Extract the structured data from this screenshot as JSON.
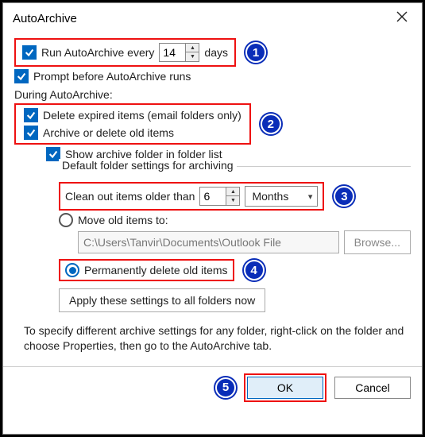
{
  "title": "AutoArchive",
  "run_every": {
    "label_prefix": "Run AutoArchive every",
    "value": "14",
    "label_suffix": "days"
  },
  "prompt_label": "Prompt before AutoArchive runs",
  "during_label": "During AutoArchive:",
  "delete_expired_label": "Delete expired items (email folders only)",
  "archive_delete_label": "Archive or delete old items",
  "show_folder_label": "Show archive folder in folder list",
  "group_legend": "Default folder settings for archiving",
  "clean_out": {
    "label": "Clean out items older than",
    "value": "6",
    "unit": "Months"
  },
  "move_label": "Move old items to:",
  "path_value": "C:\\Users\\Tanvir\\Documents\\Outlook File",
  "browse_label": "Browse...",
  "perm_delete_label": "Permanently delete old items",
  "apply_label": "Apply these settings to all folders now",
  "footer_text": "To specify different archive settings for any folder, right-click on the folder and choose Properties, then go to the AutoArchive tab.",
  "ok_label": "OK",
  "cancel_label": "Cancel",
  "steps": {
    "s1": "1",
    "s2": "2",
    "s3": "3",
    "s4": "4",
    "s5": "5"
  }
}
